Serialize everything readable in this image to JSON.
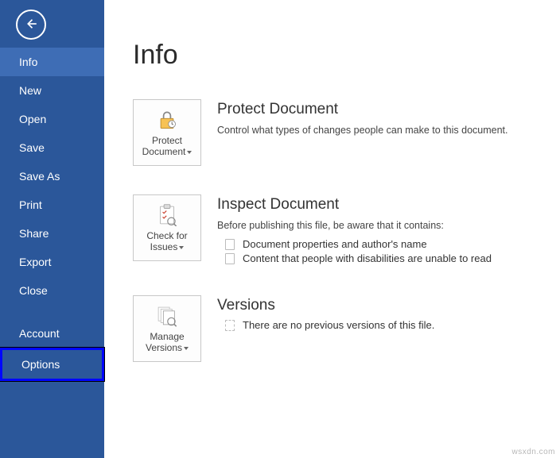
{
  "sidebar": {
    "items": [
      {
        "label": "Info",
        "selected": true
      },
      {
        "label": "New"
      },
      {
        "label": "Open"
      },
      {
        "label": "Save"
      },
      {
        "label": "Save As"
      },
      {
        "label": "Print"
      },
      {
        "label": "Share"
      },
      {
        "label": "Export"
      },
      {
        "label": "Close"
      },
      {
        "label": "Account"
      },
      {
        "label": "Options",
        "highlight": true
      }
    ]
  },
  "page": {
    "title": "Info"
  },
  "sections": {
    "protect": {
      "button_label_line1": "Protect",
      "button_label_line2": "Document",
      "title": "Protect Document",
      "desc": "Control what types of changes people can make to this document."
    },
    "inspect": {
      "button_label_line1": "Check for",
      "button_label_line2": "Issues",
      "title": "Inspect Document",
      "desc": "Before publishing this file, be aware that it contains:",
      "bullets": [
        "Document properties and author's name",
        "Content that people with disabilities are unable to read"
      ]
    },
    "versions": {
      "button_label_line1": "Manage",
      "button_label_line2": "Versions",
      "title": "Versions",
      "empty_text": "There are no previous versions of this file."
    }
  },
  "watermark": "wsxdn.com"
}
